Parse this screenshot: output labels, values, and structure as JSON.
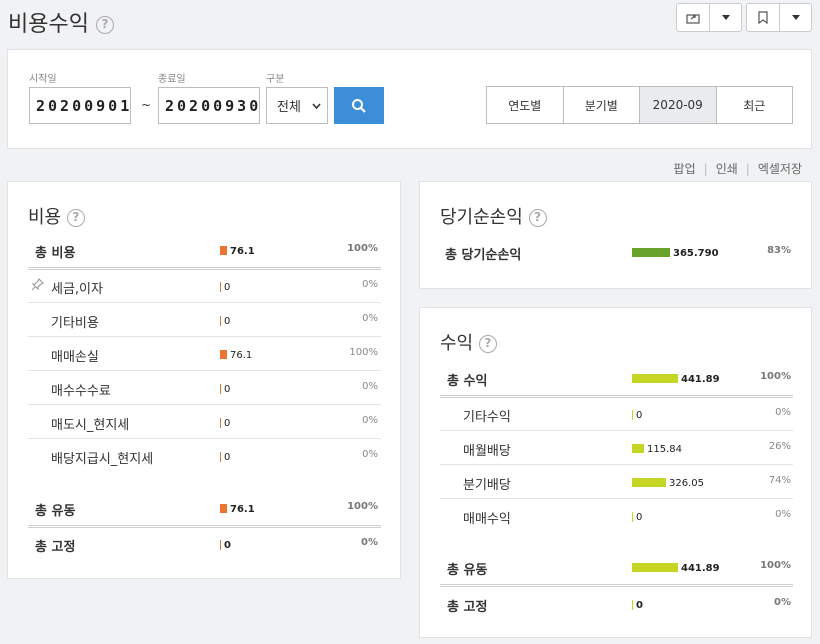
{
  "page": {
    "title": "비용수익"
  },
  "filters": {
    "start_label": "시작일",
    "start_value": "20200901",
    "end_label": "종료일",
    "end_value": "20200930",
    "tilde": "~",
    "type_label": "구분",
    "type_value": "전체"
  },
  "periods": [
    "연도별",
    "분기별",
    "2020-09",
    "최근"
  ],
  "links": {
    "popup": "팝업",
    "print": "인쇄",
    "excel": "엑셀저장"
  },
  "colors": {
    "cost": "#ec7431",
    "net": "#6aa32c",
    "revenue": "#c5d624",
    "search": "#3d8ed8"
  },
  "expense": {
    "title": "비용",
    "total": {
      "label": "총 비용",
      "value": "76.1",
      "pct": "100%",
      "level": 1.0
    },
    "items": [
      {
        "label": "세금,이자",
        "value": "0",
        "pct": "0%",
        "level": 0,
        "pinned": true
      },
      {
        "label": "기타비용",
        "value": "0",
        "pct": "0%",
        "level": 0
      },
      {
        "label": "매매손실",
        "value": "76.1",
        "pct": "100%",
        "level": 1.0
      },
      {
        "label": "매수수수료",
        "value": "0",
        "pct": "0%",
        "level": 0
      },
      {
        "label": "매도시_현지세",
        "value": "0",
        "pct": "0%",
        "level": 0
      },
      {
        "label": "배당지급시_현지세",
        "value": "0",
        "pct": "0%",
        "level": 0
      }
    ],
    "variable": {
      "label": "총 유동",
      "value": "76.1",
      "pct": "100%",
      "level": 1.0
    },
    "fixed": {
      "label": "총 고정",
      "value": "0",
      "pct": "0%",
      "level": 0
    }
  },
  "net_income": {
    "title": "당기순손익",
    "total": {
      "label": "총 당기순손익",
      "value": "365.790",
      "pct": "83%",
      "level": 0.83
    }
  },
  "revenue": {
    "title": "수익",
    "total": {
      "label": "총 수익",
      "value": "441.89",
      "pct": "100%",
      "level": 1.0
    },
    "items": [
      {
        "label": "기타수익",
        "value": "0",
        "pct": "0%",
        "level": 0
      },
      {
        "label": "매월배당",
        "value": "115.84",
        "pct": "26%",
        "level": 0.26
      },
      {
        "label": "분기배당",
        "value": "326.05",
        "pct": "74%",
        "level": 0.74
      },
      {
        "label": "매매수익",
        "value": "0",
        "pct": "0%",
        "level": 0
      }
    ],
    "variable": {
      "label": "총 유동",
      "value": "441.89",
      "pct": "100%",
      "level": 1.0
    },
    "fixed": {
      "label": "총 고정",
      "value": "0",
      "pct": "0%",
      "level": 0
    }
  }
}
